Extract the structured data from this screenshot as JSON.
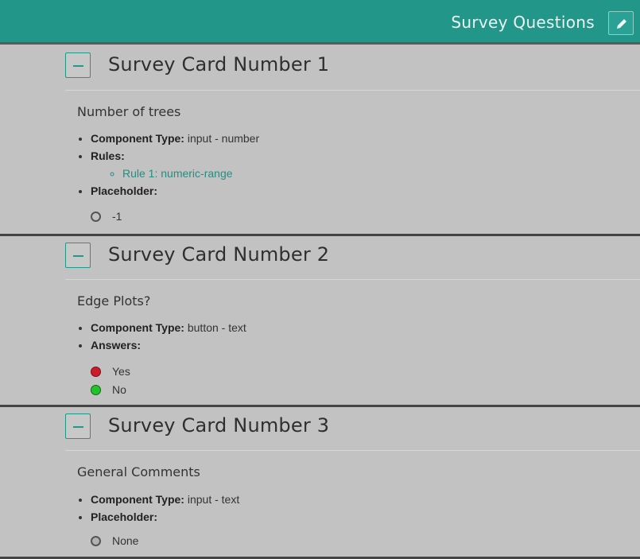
{
  "header": {
    "title": "Survey Questions",
    "edit_icon": "pencil-icon",
    "accent_color": "#23968a"
  },
  "cards": [
    {
      "title": "Survey Card Number 1",
      "question": "Number of trees",
      "component_type_label": "Component Type:",
      "component_type_value": " input - number",
      "rules_label": "Rules:",
      "rules": [
        "Rule 1: numeric-range"
      ],
      "placeholder_label": "Placeholder:",
      "placeholder_value": "-1"
    },
    {
      "title": "Survey Card Number 2",
      "question": "Edge Plots?",
      "component_type_label": "Component Type:",
      "component_type_value": " button - text",
      "answers_label": "Answers:",
      "answers": [
        {
          "label": "Yes",
          "color": "#cc1b2b"
        },
        {
          "label": "No",
          "color": "#22c22a"
        }
      ]
    },
    {
      "title": "Survey Card Number 3",
      "question": "General Comments",
      "component_type_label": "Component Type:",
      "component_type_value": " input - text",
      "placeholder_label": "Placeholder:",
      "placeholder_value": "None"
    }
  ]
}
